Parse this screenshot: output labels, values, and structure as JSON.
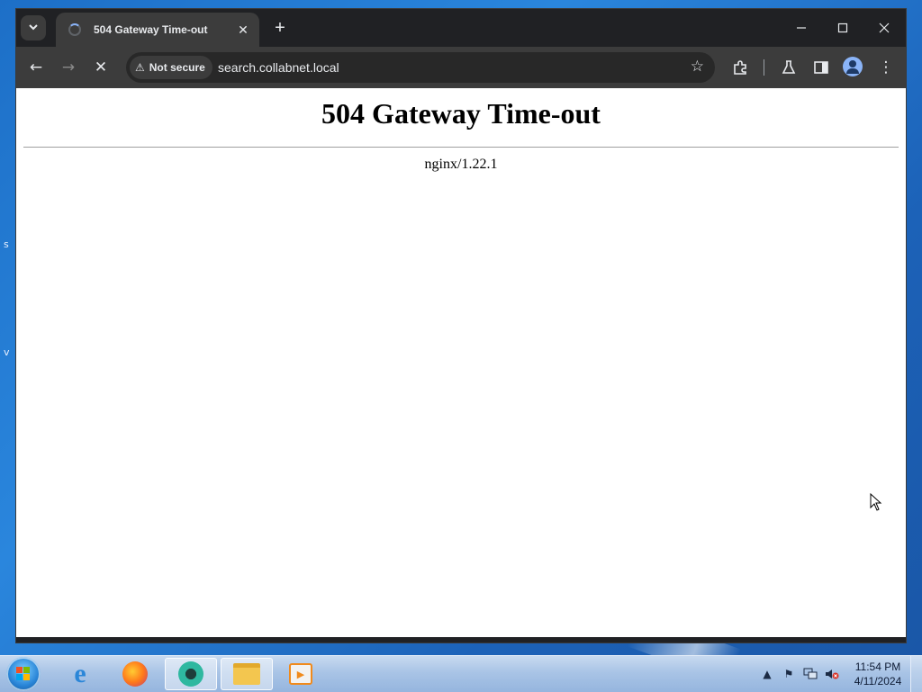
{
  "browser": {
    "tab": {
      "title": "504 Gateway Time-out",
      "close_glyph": "✕"
    },
    "new_tab_glyph": "+",
    "window_controls": {
      "minimize": "—",
      "maximize": "☐",
      "close": "✕"
    },
    "toolbar": {
      "back_glyph": "←",
      "forward_glyph": "→",
      "stop_glyph": "✕",
      "security_label": "Not secure",
      "url": "search.collabnet.local",
      "star_glyph": "☆",
      "menu_glyph": "⋮"
    }
  },
  "page": {
    "heading": "504 Gateway Time-out",
    "server": "nginx/1.22.1"
  },
  "taskbar": {
    "clock_time": "11:54 PM",
    "clock_date": "4/11/2024",
    "apps": [
      "internet-explorer",
      "firefox",
      "browser-active",
      "file-explorer",
      "media-player"
    ]
  },
  "icons": {
    "tab_search": "chevron-down-icon",
    "extensions": "puzzle-icon",
    "labs": "flask-icon",
    "side_panel": "side-panel-icon",
    "profile": "profile-icon"
  },
  "colors": {
    "chrome_dark": "#202124",
    "toolbar": "#3c3c3c",
    "page_bg": "#ffffff",
    "desktop_blue": "#1d6fc7"
  }
}
